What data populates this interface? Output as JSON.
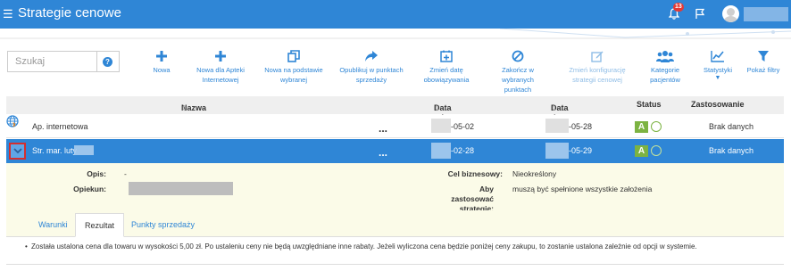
{
  "app": {
    "menu_icon": "hamburger-icon",
    "title": "Strategie cenowe",
    "notification_count": "13",
    "accent_color": "#2f86d6"
  },
  "search": {
    "placeholder": "Szukaj",
    "help_icon": "?"
  },
  "toolbar": [
    {
      "id": "new",
      "icon": "plus-icon",
      "label": "Nowa",
      "enabled": true
    },
    {
      "id": "new-internet",
      "icon": "plus-icon",
      "label": "Nowa dla Apteki Internetowej",
      "enabled": true
    },
    {
      "id": "new-based",
      "icon": "copy-icon",
      "label": "Nowa na podstawie wybranej",
      "enabled": true
    },
    {
      "id": "publish",
      "icon": "share-arrow-icon",
      "label": "Opublikuj w punktach sprzedaży",
      "enabled": true
    },
    {
      "id": "change-date",
      "icon": "calendar-plus-icon",
      "label": "Zmień datę obowiązywania",
      "enabled": true
    },
    {
      "id": "end",
      "icon": "ban-icon",
      "label": "Zakończ w wybranych punktach",
      "enabled": true
    },
    {
      "id": "config",
      "icon": "edit-icon",
      "label": "Zmień konfigurację strategii cenowej",
      "enabled": false
    },
    {
      "id": "categories",
      "icon": "users-icon",
      "label": "Kategorie pacjentów",
      "enabled": true
    },
    {
      "id": "stats",
      "icon": "line-chart-icon",
      "label": "Statystyki",
      "enabled": true
    },
    {
      "id": "filters",
      "icon": "filter-icon",
      "label": "Pokaż filtry",
      "enabled": true
    }
  ],
  "table": {
    "headers": {
      "name": "Nazwa",
      "date_from": "Data od",
      "date_to": "Data do",
      "status": "Status",
      "usage": "Zastosowanie"
    },
    "rows": [
      {
        "name": "Ap. internetowa",
        "actions": "...",
        "date_from": "-05-02",
        "date_to": "-05-28",
        "status": "A",
        "usage": "Brak danych"
      },
      {
        "name": "Str. mar. luty",
        "actions": "...",
        "date_from": "-02-28",
        "date_to": "-05-29",
        "status": "A",
        "usage": "Brak danych"
      }
    ]
  },
  "detail": {
    "opis_label": "Opis:",
    "opis_value": "-",
    "opiekun_label": "Opiekun:",
    "cel_label": "Cel biznesowy:",
    "cel_value": "Nieokreślony",
    "aby_label": "Aby zastosować strategię:",
    "aby_value": "muszą być spełnione wszystkie założenia"
  },
  "tabs": [
    {
      "label": "Warunki"
    },
    {
      "label": "Rezultat"
    },
    {
      "label": "Punkty sprzedaży"
    }
  ],
  "result_text": "Została ustalona cena dla towaru w wysokości 5,00 zł. Po ustaleniu ceny nie będą uwzględniane inne rabaty. Jeżeli wyliczona cena będzie poniżej ceny zakupu, to zostanie ustalona zależnie od opcji w systemie."
}
